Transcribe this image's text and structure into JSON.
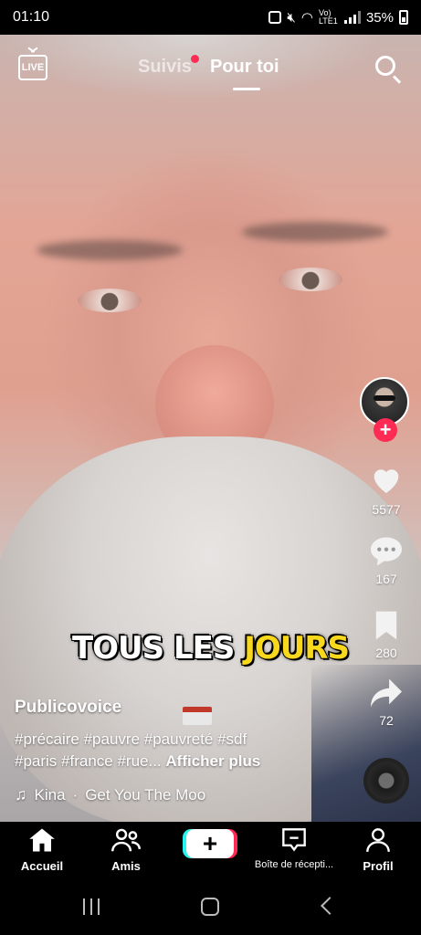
{
  "status_bar": {
    "time": "01:10",
    "network": "Vo) LTE1",
    "battery": "35%"
  },
  "top_nav": {
    "live_label": "LIVE",
    "tabs": [
      {
        "label": "Suivis",
        "active": false,
        "has_dot": true
      },
      {
        "label": "Pour toi",
        "active": true
      }
    ]
  },
  "video": {
    "caption_part1": "TOUS LES ",
    "caption_part2": "JOURS",
    "username": "Publicovoice",
    "description_line1": "#précaire #pauvre #pauvreté #sdf",
    "description_line2": "#paris #france #rue...",
    "more_label": "Afficher plus",
    "music_artist": "Kina",
    "music_title": "Get You The Moo"
  },
  "actions": {
    "likes": "5577",
    "comments": "167",
    "saves": "280",
    "shares": "72"
  },
  "bottom_nav": {
    "items": [
      {
        "label": "Accueil",
        "icon": "home-icon",
        "active": true
      },
      {
        "label": "Amis",
        "icon": "friends-icon"
      },
      {
        "label": "+",
        "icon": "create-icon"
      },
      {
        "label": "Boîte de récepti...",
        "icon": "inbox-icon"
      },
      {
        "label": "Profil",
        "icon": "profile-icon"
      }
    ]
  },
  "colors": {
    "accent_red": "#fe2c55",
    "accent_cyan": "#25f4ee",
    "caption_yellow": "#f8d81c"
  }
}
